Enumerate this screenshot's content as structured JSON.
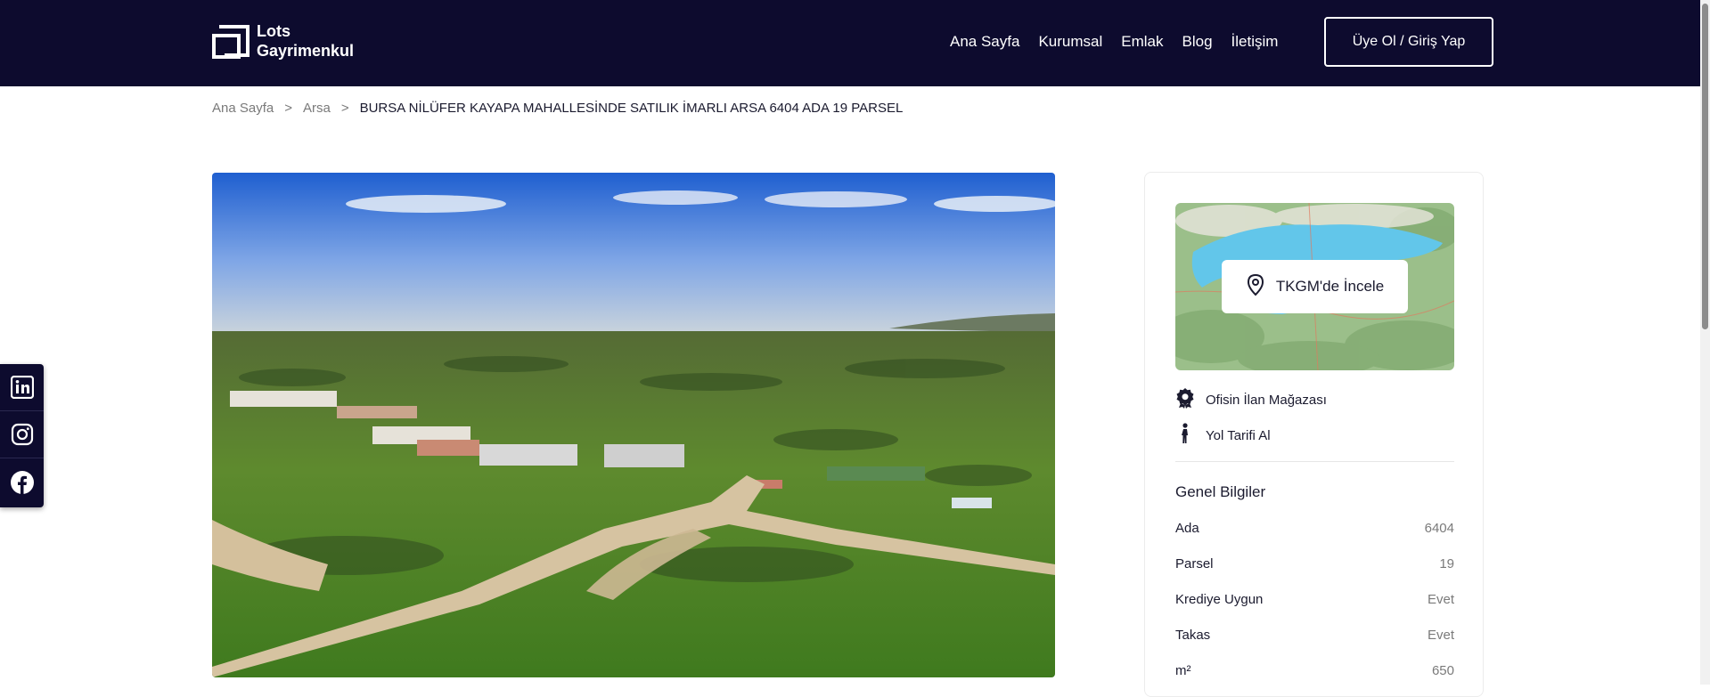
{
  "header": {
    "logo_line1": "Lots",
    "logo_line2": "Gayrimenkul",
    "nav": [
      "Ana Sayfa",
      "Kurumsal",
      "Emlak",
      "Blog",
      "İletişim"
    ],
    "auth_button": "Üye Ol / Giriş Yap"
  },
  "breadcrumb": {
    "items": [
      "Ana Sayfa",
      "Arsa"
    ],
    "separator": ">",
    "current": "BURSA NİLÜFER KAYAPA MAHALLESİNDE SATILIK İMARLI ARSA 6404 ADA 19 PARSEL"
  },
  "social": [
    "linkedin-icon",
    "instagram-icon",
    "facebook-icon"
  ],
  "sidebar": {
    "map_button": "TKGM'de İncele",
    "store_link": "Ofisin İlan Mağazası",
    "directions_link": "Yol Tarifi Al",
    "section_title": "Genel Bilgiler",
    "info": [
      {
        "label": "Ada",
        "value": "6404"
      },
      {
        "label": "Parsel",
        "value": "19"
      },
      {
        "label": "Krediye Uygun",
        "value": "Evet"
      },
      {
        "label": "Takas",
        "value": "Evet"
      },
      {
        "label": "m²",
        "value": "650"
      }
    ]
  },
  "colors": {
    "header_bg": "#0d0b2e",
    "text": "#1b1b2f",
    "muted": "#7a7a7a"
  }
}
